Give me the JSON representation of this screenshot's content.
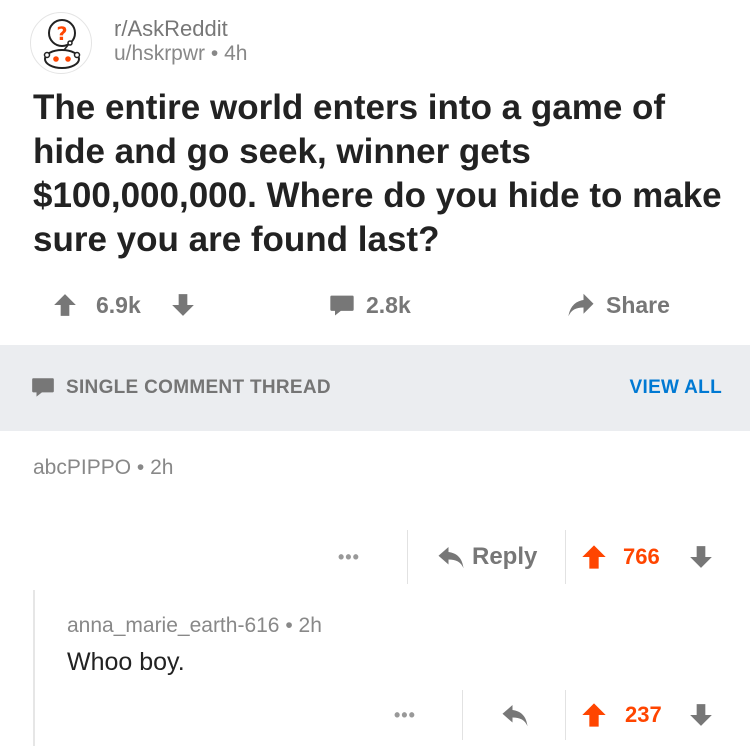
{
  "post": {
    "subreddit": "r/AskReddit",
    "author": "u/hskrpwr",
    "separator": "•",
    "age": "4h",
    "title": "The entire world enters into a game of hide and go seek, winner gets $100,000,000. Where do you hide to make sure you are found last?",
    "score": "6.9k",
    "comments": "2.8k",
    "share_label": "Share"
  },
  "thread": {
    "label": "SINGLE COMMENT THREAD",
    "view_all": "VIEW ALL"
  },
  "comment": {
    "author": "abcPIPPO",
    "separator": "•",
    "age": "2h",
    "more": "•••",
    "reply_label": "Reply",
    "score": "766"
  },
  "reply": {
    "author": "anna_marie_earth-616",
    "separator": "•",
    "age": "2h",
    "body": "Whoo boy.",
    "more": "•••",
    "score": "237"
  },
  "colors": {
    "upvote_active": "#ff4500",
    "link_blue": "#0079d3",
    "muted_gray": "#777777",
    "thread_bar_bg": "#ebedf0"
  }
}
